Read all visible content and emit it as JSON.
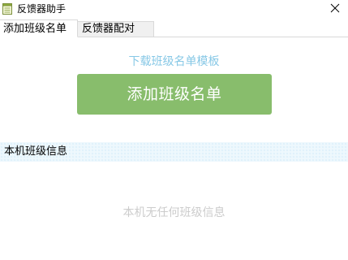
{
  "window": {
    "title": "反馈器助手",
    "icon": "notepad-icon",
    "close_icon": "close-icon"
  },
  "tabs": [
    {
      "label": "添加班级名单",
      "active": true
    },
    {
      "label": "反馈器配对",
      "active": false
    }
  ],
  "main": {
    "download_link": "下载班级名单模板",
    "add_button": "添加班级名单",
    "add_button_color": "#88bd6c",
    "link_color": "#87c8e6"
  },
  "class_info": {
    "header": "本机班级信息",
    "empty_text": "本机无任何班级信息"
  }
}
